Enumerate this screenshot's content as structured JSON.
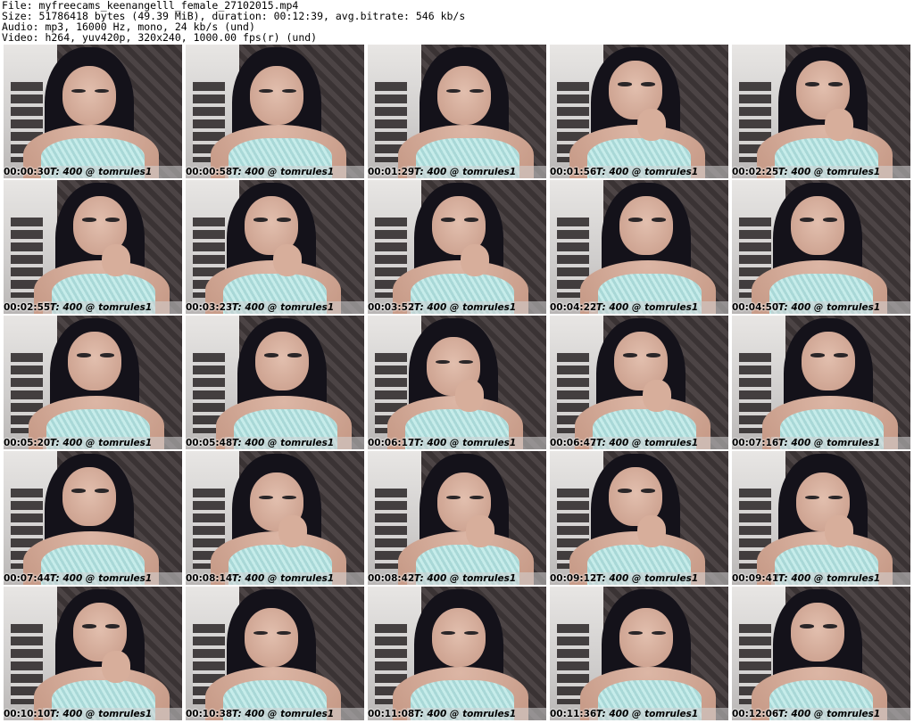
{
  "header": {
    "line1": "File: myfreecams_keenangelll_female_27102015.mp4",
    "line2": "Size: 51786418 bytes (49.39 MiB), duration: 00:12:39, avg.bitrate: 546 kb/s",
    "line3": "Audio: mp3, 16000 Hz, mono, 24 kb/s (und)",
    "line4": "Video: h264, yuv420p, 320x240, 1000.00 fps(r) (und)"
  },
  "overlay_text": "IT: 400 @ tomrules1",
  "thumbnails": [
    {
      "time": "00:00:30",
      "pose": "down",
      "hand": false
    },
    {
      "time": "00:00:58",
      "pose": "down",
      "hand": false
    },
    {
      "time": "00:01:29",
      "pose": "down",
      "hand": false
    },
    {
      "time": "00:01:56",
      "pose": "front",
      "hand": true
    },
    {
      "time": "00:02:25",
      "pose": "front",
      "hand": true
    },
    {
      "time": "00:02:55",
      "pose": "front",
      "hand": true
    },
    {
      "time": "00:03:23",
      "pose": "front",
      "hand": true
    },
    {
      "time": "00:03:52",
      "pose": "front",
      "hand": true
    },
    {
      "time": "00:04:22",
      "pose": "front",
      "hand": false
    },
    {
      "time": "00:04:50",
      "pose": "front",
      "hand": false
    },
    {
      "time": "00:05:20",
      "pose": "front",
      "hand": false
    },
    {
      "time": "00:05:48",
      "pose": "front",
      "hand": false
    },
    {
      "time": "00:06:17",
      "pose": "down",
      "hand": true
    },
    {
      "time": "00:06:47",
      "pose": "front",
      "hand": true
    },
    {
      "time": "00:07:16",
      "pose": "front",
      "hand": false
    },
    {
      "time": "00:07:44",
      "pose": "front",
      "hand": false
    },
    {
      "time": "00:08:14",
      "pose": "down",
      "hand": true
    },
    {
      "time": "00:08:42",
      "pose": "down",
      "hand": true
    },
    {
      "time": "00:09:12",
      "pose": "front",
      "hand": true
    },
    {
      "time": "00:09:41",
      "pose": "down",
      "hand": true
    },
    {
      "time": "00:10:10",
      "pose": "front",
      "hand": true
    },
    {
      "time": "00:10:38",
      "pose": "down",
      "hand": false
    },
    {
      "time": "00:11:08",
      "pose": "down",
      "hand": false
    },
    {
      "time": "00:11:36",
      "pose": "down",
      "hand": false
    },
    {
      "time": "00:12:06",
      "pose": "front",
      "hand": false
    }
  ]
}
